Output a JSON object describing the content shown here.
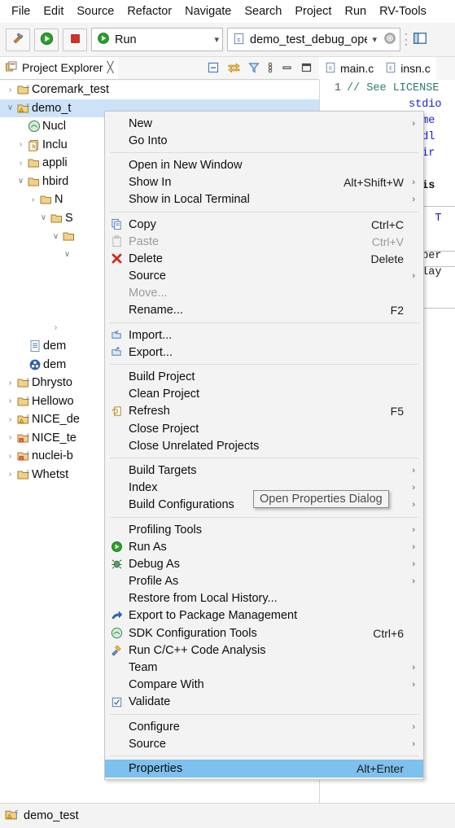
{
  "window": {
    "menubar": [
      "File",
      "Edit",
      "Source",
      "Refactor",
      "Navigate",
      "Search",
      "Project",
      "Run",
      "RV-Tools"
    ]
  },
  "toolbar": {
    "build_icon": "hammer-icon",
    "run_icon": "run-icon",
    "stop_icon": "stop-icon",
    "run_combo_value": "Run",
    "launch_combo_value": "demo_test_debug_open",
    "settings_icon": "gear-icon"
  },
  "project_explorer": {
    "tab_label": "Project Explorer",
    "tab_icon": "project-explorer-icon",
    "close_icon": "close-icon",
    "tools": [
      "collapse-all-icon",
      "link-with-editor-icon",
      "filter-icon",
      "view-menu-icon",
      "minimize-icon",
      "maximize-icon"
    ],
    "tree": [
      {
        "indent": 0,
        "arrow": "›",
        "icon": "c-project-icon",
        "label": "Coremark_test",
        "selected": false
      },
      {
        "indent": 0,
        "arrow": "∨",
        "icon": "c-project-warn-icon",
        "label": "demo_t",
        "selected": true
      },
      {
        "indent": 1,
        "arrow": "",
        "icon": "sdk-icon",
        "label": "Nucl",
        "selected": false
      },
      {
        "indent": 1,
        "arrow": "›",
        "icon": "includes-icon",
        "label": "Inclu",
        "selected": false
      },
      {
        "indent": 1,
        "arrow": "›",
        "icon": "folder-icon",
        "label": "appli",
        "selected": false
      },
      {
        "indent": 1,
        "arrow": "∨",
        "icon": "folder-icon",
        "label": "hbird",
        "selected": false
      },
      {
        "indent": 2,
        "arrow": "›",
        "icon": "folder-icon",
        "label": "N",
        "selected": false
      },
      {
        "indent": 2,
        "arrow": "∨",
        "icon": "folder-icon",
        "label": "S",
        "selected": false
      },
      {
        "indent": 3,
        "arrow": "∨",
        "icon": "folder-icon",
        "label": "",
        "selected": false
      },
      {
        "indent": 4,
        "arrow": "∨",
        "icon": "",
        "label": "",
        "selected": false
      },
      {
        "indent": 0,
        "arrow": "",
        "icon": "",
        "label": "",
        "selected": false
      },
      {
        "indent": 0,
        "arrow": "",
        "icon": "",
        "label": "",
        "selected": false
      },
      {
        "indent": 0,
        "arrow": "",
        "icon": "",
        "label": "",
        "selected": false
      },
      {
        "indent": 3,
        "arrow": "›",
        "icon": "",
        "label": "",
        "selected": false
      },
      {
        "indent": 2,
        "arrow": "",
        "icon": "file-icon",
        "label": "dem",
        "selected": false
      },
      {
        "indent": 2,
        "arrow": "",
        "icon": "binary-icon",
        "label": "dem",
        "selected": false
      },
      {
        "indent": 0,
        "arrow": "›",
        "icon": "c-project-icon",
        "label": "Dhrysto",
        "selected": false
      },
      {
        "indent": 0,
        "arrow": "›",
        "icon": "c-project-icon",
        "label": "Hellowo",
        "selected": false
      },
      {
        "indent": 0,
        "arrow": "›",
        "icon": "c-project-warn-icon",
        "label": "NICE_de",
        "selected": false
      },
      {
        "indent": 0,
        "arrow": "›",
        "icon": "c-project-error-icon",
        "label": "NICE_te",
        "selected": false
      },
      {
        "indent": 0,
        "arrow": "›",
        "icon": "c-project-error-icon",
        "label": "nuclei-b",
        "selected": false
      },
      {
        "indent": 0,
        "arrow": "›",
        "icon": "c-project-icon",
        "label": "Whetst",
        "selected": false
      }
    ]
  },
  "editor": {
    "tabs": [
      {
        "label": "main.c",
        "icon": "c-file-icon"
      },
      {
        "label": "insn.c",
        "icon": "c-file-icon"
      }
    ],
    "lines": [
      {
        "no": "1",
        "text": "// See LICENSE",
        "cls": "c-comment"
      },
      {
        "no": "",
        "text": "stdio",
        "cls": "c-blue"
      },
      {
        "no": "",
        "text": "time",
        "cls": "c-blue"
      },
      {
        "no": "",
        "text": "stdl",
        "cls": "c-blue"
      },
      {
        "no": "",
        "text": "hbir",
        "cls": "c-blue"
      },
      {
        "no": "",
        "text": "",
        "cls": ""
      },
      {
        "no": "",
        "text": "_mis",
        "cls": "c-bold"
      },
      {
        "no": "",
        "text": "",
        "cls": ""
      },
      {
        "no": "",
        "text": "SA  T",
        "cls": "c-blue"
      },
      {
        "no": "",
        "text": "",
        "cls": ""
      },
      {
        "no": "",
        "text": "roper",
        "cls": ""
      },
      {
        "no": "",
        "text": "splay",
        "cls": ""
      }
    ]
  },
  "context_menu": {
    "items": [
      {
        "type": "item",
        "label": "New",
        "accel": "",
        "arrow": true,
        "icon": "",
        "disabled": false
      },
      {
        "type": "item",
        "label": "Go Into",
        "accel": "",
        "arrow": false,
        "icon": "",
        "disabled": false
      },
      {
        "type": "sep"
      },
      {
        "type": "item",
        "label": "Open in New Window",
        "accel": "",
        "arrow": false,
        "icon": "",
        "disabled": false
      },
      {
        "type": "item",
        "label": "Show In",
        "accel": "Alt+Shift+W",
        "arrow": true,
        "icon": "",
        "disabled": false
      },
      {
        "type": "item",
        "label": "Show in Local Terminal",
        "accel": "",
        "arrow": true,
        "icon": "",
        "disabled": false
      },
      {
        "type": "sep"
      },
      {
        "type": "item",
        "label": "Copy",
        "accel": "Ctrl+C",
        "arrow": false,
        "icon": "copy-icon",
        "disabled": false
      },
      {
        "type": "item",
        "label": "Paste",
        "accel": "Ctrl+V",
        "arrow": false,
        "icon": "paste-icon",
        "disabled": true
      },
      {
        "type": "item",
        "label": "Delete",
        "accel": "Delete",
        "arrow": false,
        "icon": "delete-icon",
        "disabled": false
      },
      {
        "type": "item",
        "label": "Source",
        "accel": "",
        "arrow": true,
        "icon": "",
        "disabled": false
      },
      {
        "type": "item",
        "label": "Move...",
        "accel": "",
        "arrow": false,
        "icon": "",
        "disabled": true
      },
      {
        "type": "item",
        "label": "Rename...",
        "accel": "F2",
        "arrow": false,
        "icon": "",
        "disabled": false
      },
      {
        "type": "sep"
      },
      {
        "type": "item",
        "label": "Import...",
        "accel": "",
        "arrow": false,
        "icon": "import-icon",
        "disabled": false
      },
      {
        "type": "item",
        "label": "Export...",
        "accel": "",
        "arrow": false,
        "icon": "export-icon",
        "disabled": false
      },
      {
        "type": "sep"
      },
      {
        "type": "item",
        "label": "Build Project",
        "accel": "",
        "arrow": false,
        "icon": "",
        "disabled": false
      },
      {
        "type": "item",
        "label": "Clean Project",
        "accel": "",
        "arrow": false,
        "icon": "",
        "disabled": false
      },
      {
        "type": "item",
        "label": "Refresh",
        "accel": "F5",
        "arrow": false,
        "icon": "refresh-icon",
        "disabled": false
      },
      {
        "type": "item",
        "label": "Close Project",
        "accel": "",
        "arrow": false,
        "icon": "",
        "disabled": false
      },
      {
        "type": "item",
        "label": "Close Unrelated Projects",
        "accel": "",
        "arrow": false,
        "icon": "",
        "disabled": false
      },
      {
        "type": "sep"
      },
      {
        "type": "item",
        "label": "Build Targets",
        "accel": "",
        "arrow": true,
        "icon": "",
        "disabled": false
      },
      {
        "type": "item",
        "label": "Index",
        "accel": "",
        "arrow": true,
        "icon": "",
        "disabled": false
      },
      {
        "type": "item",
        "label": "Build Configurations",
        "accel": "",
        "arrow": true,
        "icon": "",
        "disabled": false
      },
      {
        "type": "sep"
      },
      {
        "type": "item",
        "label": "Profiling Tools",
        "accel": "",
        "arrow": true,
        "icon": "",
        "disabled": false
      },
      {
        "type": "item",
        "label": "Run As",
        "accel": "",
        "arrow": true,
        "icon": "run-icon",
        "disabled": false
      },
      {
        "type": "item",
        "label": "Debug As",
        "accel": "",
        "arrow": true,
        "icon": "debug-icon",
        "disabled": false
      },
      {
        "type": "item",
        "label": "Profile As",
        "accel": "",
        "arrow": true,
        "icon": "",
        "disabled": false
      },
      {
        "type": "item",
        "label": "Restore from Local History...",
        "accel": "",
        "arrow": false,
        "icon": "",
        "disabled": false
      },
      {
        "type": "item",
        "label": "Export to Package Management",
        "accel": "",
        "arrow": false,
        "icon": "package-export-icon",
        "disabled": false
      },
      {
        "type": "item",
        "label": "SDK Configuration Tools",
        "accel": "Ctrl+6",
        "arrow": false,
        "icon": "sdk-icon",
        "disabled": false
      },
      {
        "type": "item",
        "label": "Run C/C++ Code Analysis",
        "accel": "",
        "arrow": false,
        "icon": "code-analysis-icon",
        "disabled": false
      },
      {
        "type": "item",
        "label": "Team",
        "accel": "",
        "arrow": true,
        "icon": "",
        "disabled": false
      },
      {
        "type": "item",
        "label": "Compare With",
        "accel": "",
        "arrow": true,
        "icon": "",
        "disabled": false
      },
      {
        "type": "item",
        "label": "Validate",
        "accel": "",
        "arrow": false,
        "icon": "checkbox-icon",
        "disabled": false
      },
      {
        "type": "sep"
      },
      {
        "type": "item",
        "label": "Configure",
        "accel": "",
        "arrow": true,
        "icon": "",
        "disabled": false
      },
      {
        "type": "item",
        "label": "Source",
        "accel": "",
        "arrow": true,
        "icon": "",
        "disabled": false
      },
      {
        "type": "sep"
      },
      {
        "type": "item",
        "label": "Properties",
        "accel": "Alt+Enter",
        "arrow": false,
        "icon": "",
        "disabled": false,
        "highlighted": true
      }
    ]
  },
  "tooltip": {
    "text": "Open Properties Dialog"
  },
  "statusbar": {
    "label": "demo_test",
    "icon": "c-project-warn-icon"
  },
  "colors": {
    "highlight": "#7ec0ee",
    "tree_selection": "#cce2f7",
    "menu_bg": "#f3f3f3",
    "comment": "#2e7d6e",
    "preproc": "#5b2a9e",
    "keyword_blue": "#1a1ad6"
  }
}
